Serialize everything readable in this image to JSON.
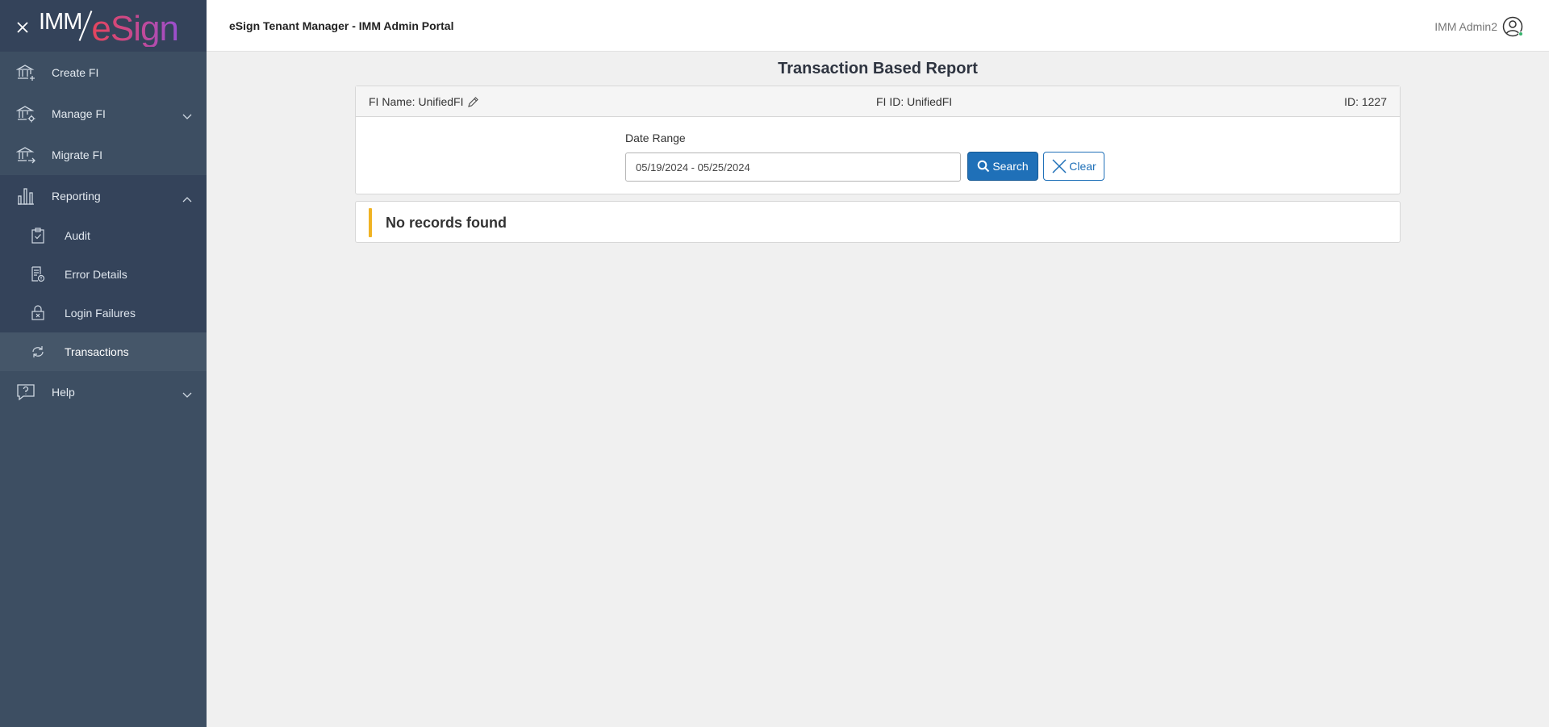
{
  "brand": {
    "left": "IMM",
    "right": "eSign"
  },
  "sidebar": {
    "items": [
      {
        "label": "Create FI",
        "icon": "bank-plus-icon"
      },
      {
        "label": "Manage FI",
        "icon": "bank-gear-icon"
      },
      {
        "label": "Migrate FI",
        "icon": "bank-arrow-icon"
      },
      {
        "label": "Reporting",
        "icon": "bar-chart-icon"
      },
      {
        "label": "Help",
        "icon": "help-bubble-icon"
      }
    ],
    "reporting_sub": [
      {
        "label": "Audit",
        "icon": "clipboard-check-icon"
      },
      {
        "label": "Error Details",
        "icon": "doc-error-icon"
      },
      {
        "label": "Login Failures",
        "icon": "lock-x-icon"
      },
      {
        "label": "Transactions",
        "icon": "sync-icon"
      }
    ]
  },
  "header": {
    "title": "eSign Tenant Manager - IMM Admin Portal",
    "user": "IMM Admin2"
  },
  "main": {
    "page_title": "Transaction Based Report",
    "fi_name": "FI Name: UnifiedFI",
    "fi_id": "FI ID: UnifiedFI",
    "id": "ID: 1227",
    "date_label": "Date Range",
    "date_value": "05/19/2024 - 05/25/2024",
    "search_label": "Search",
    "clear_label": "Clear",
    "message": "No records found"
  },
  "colors": {
    "sidebar_bg": "#3d4e62",
    "primary": "#1f70b8",
    "alert_accent": "#f0b323"
  }
}
